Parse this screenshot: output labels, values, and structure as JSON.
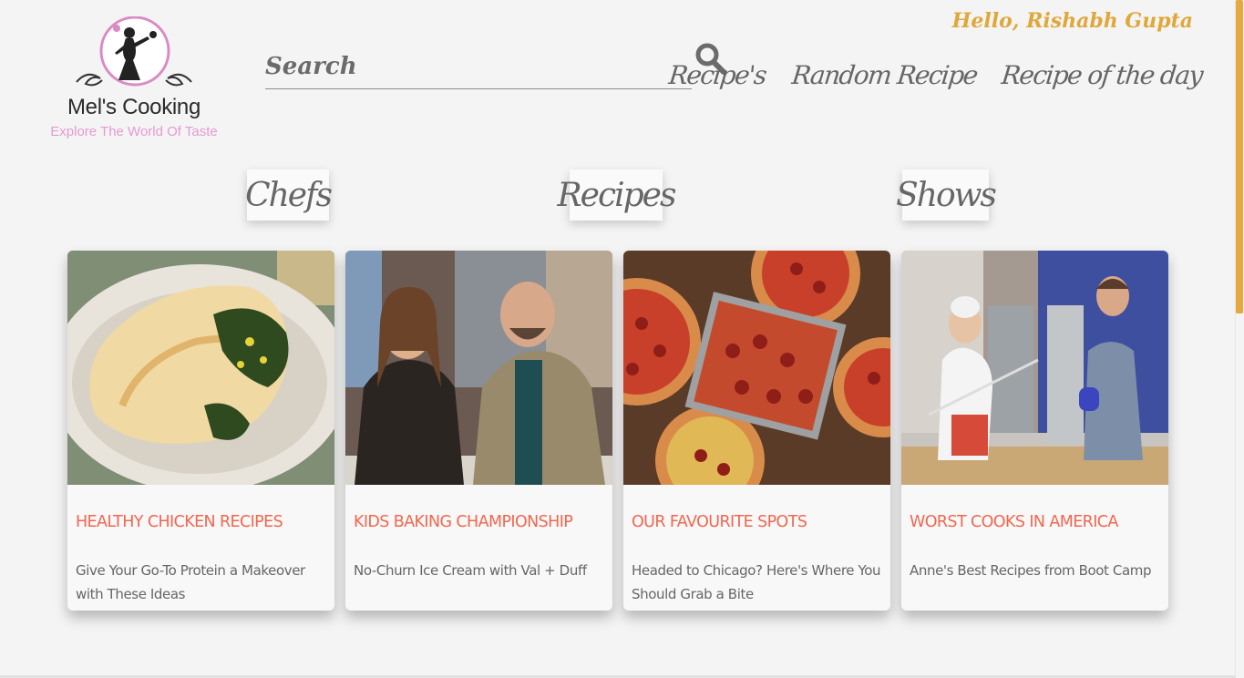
{
  "brand": {
    "name": "Mel's Cooking",
    "tagline": "Explore The World Of Taste"
  },
  "search": {
    "placeholder": "Search"
  },
  "user": {
    "greeting": "Hello, Rishabh Gupta"
  },
  "nav": [
    {
      "label": "Recipe's"
    },
    {
      "label": "Random Recipe"
    },
    {
      "label": "Recipe of the day"
    }
  ],
  "categories": [
    {
      "label": "Chefs"
    },
    {
      "label": "Recipes"
    },
    {
      "label": "Shows"
    }
  ],
  "cards": [
    {
      "title": "HEALTHY CHICKEN RECIPES",
      "description": "Give Your Go-To Protein a Makeover with These Ideas",
      "image": "stuffed-chicken-breast"
    },
    {
      "title": "KIDS BAKING CHAMPIONSHIP",
      "description": "No-Churn Ice Cream with Val + Duff",
      "image": "hosts-in-kitchen"
    },
    {
      "title": "OUR FAVOURITE SPOTS",
      "description": "Headed to Chicago? Here's Where You Should Grab a Bite",
      "image": "pepperoni-pizzas"
    },
    {
      "title": "WORST COOKS IN AMERICA",
      "description": "Anne's Best Recipes from Boot Camp",
      "image": "chef-in-kitchen"
    }
  ],
  "colors": {
    "accent": "#e0a73a",
    "card_title": "#f2664f",
    "text": "#666666",
    "logo_pink": "#e59ad0"
  }
}
